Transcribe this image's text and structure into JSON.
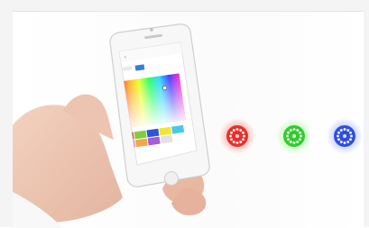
{
  "phone": {
    "screen_title": "",
    "back_glyph": "‹",
    "top_right_label": "",
    "tab_label": ""
  },
  "palette": {
    "colors": [
      "#e63a2f",
      "#7fcf3a",
      "#2f55d8",
      "#f2e43a",
      "#49c7e8",
      "#d86ad6",
      "#f2a84a",
      "#a65bd8",
      "#e2e2e2"
    ]
  },
  "lights": [
    {
      "color": "#e8302c",
      "glow": "#ff5d52",
      "name": "red-led"
    },
    {
      "color": "#31cc2f",
      "glow": "#7cff6b",
      "name": "green-led"
    },
    {
      "color": "#2f4fe0",
      "glow": "#6f8cff",
      "name": "blue-led"
    }
  ]
}
